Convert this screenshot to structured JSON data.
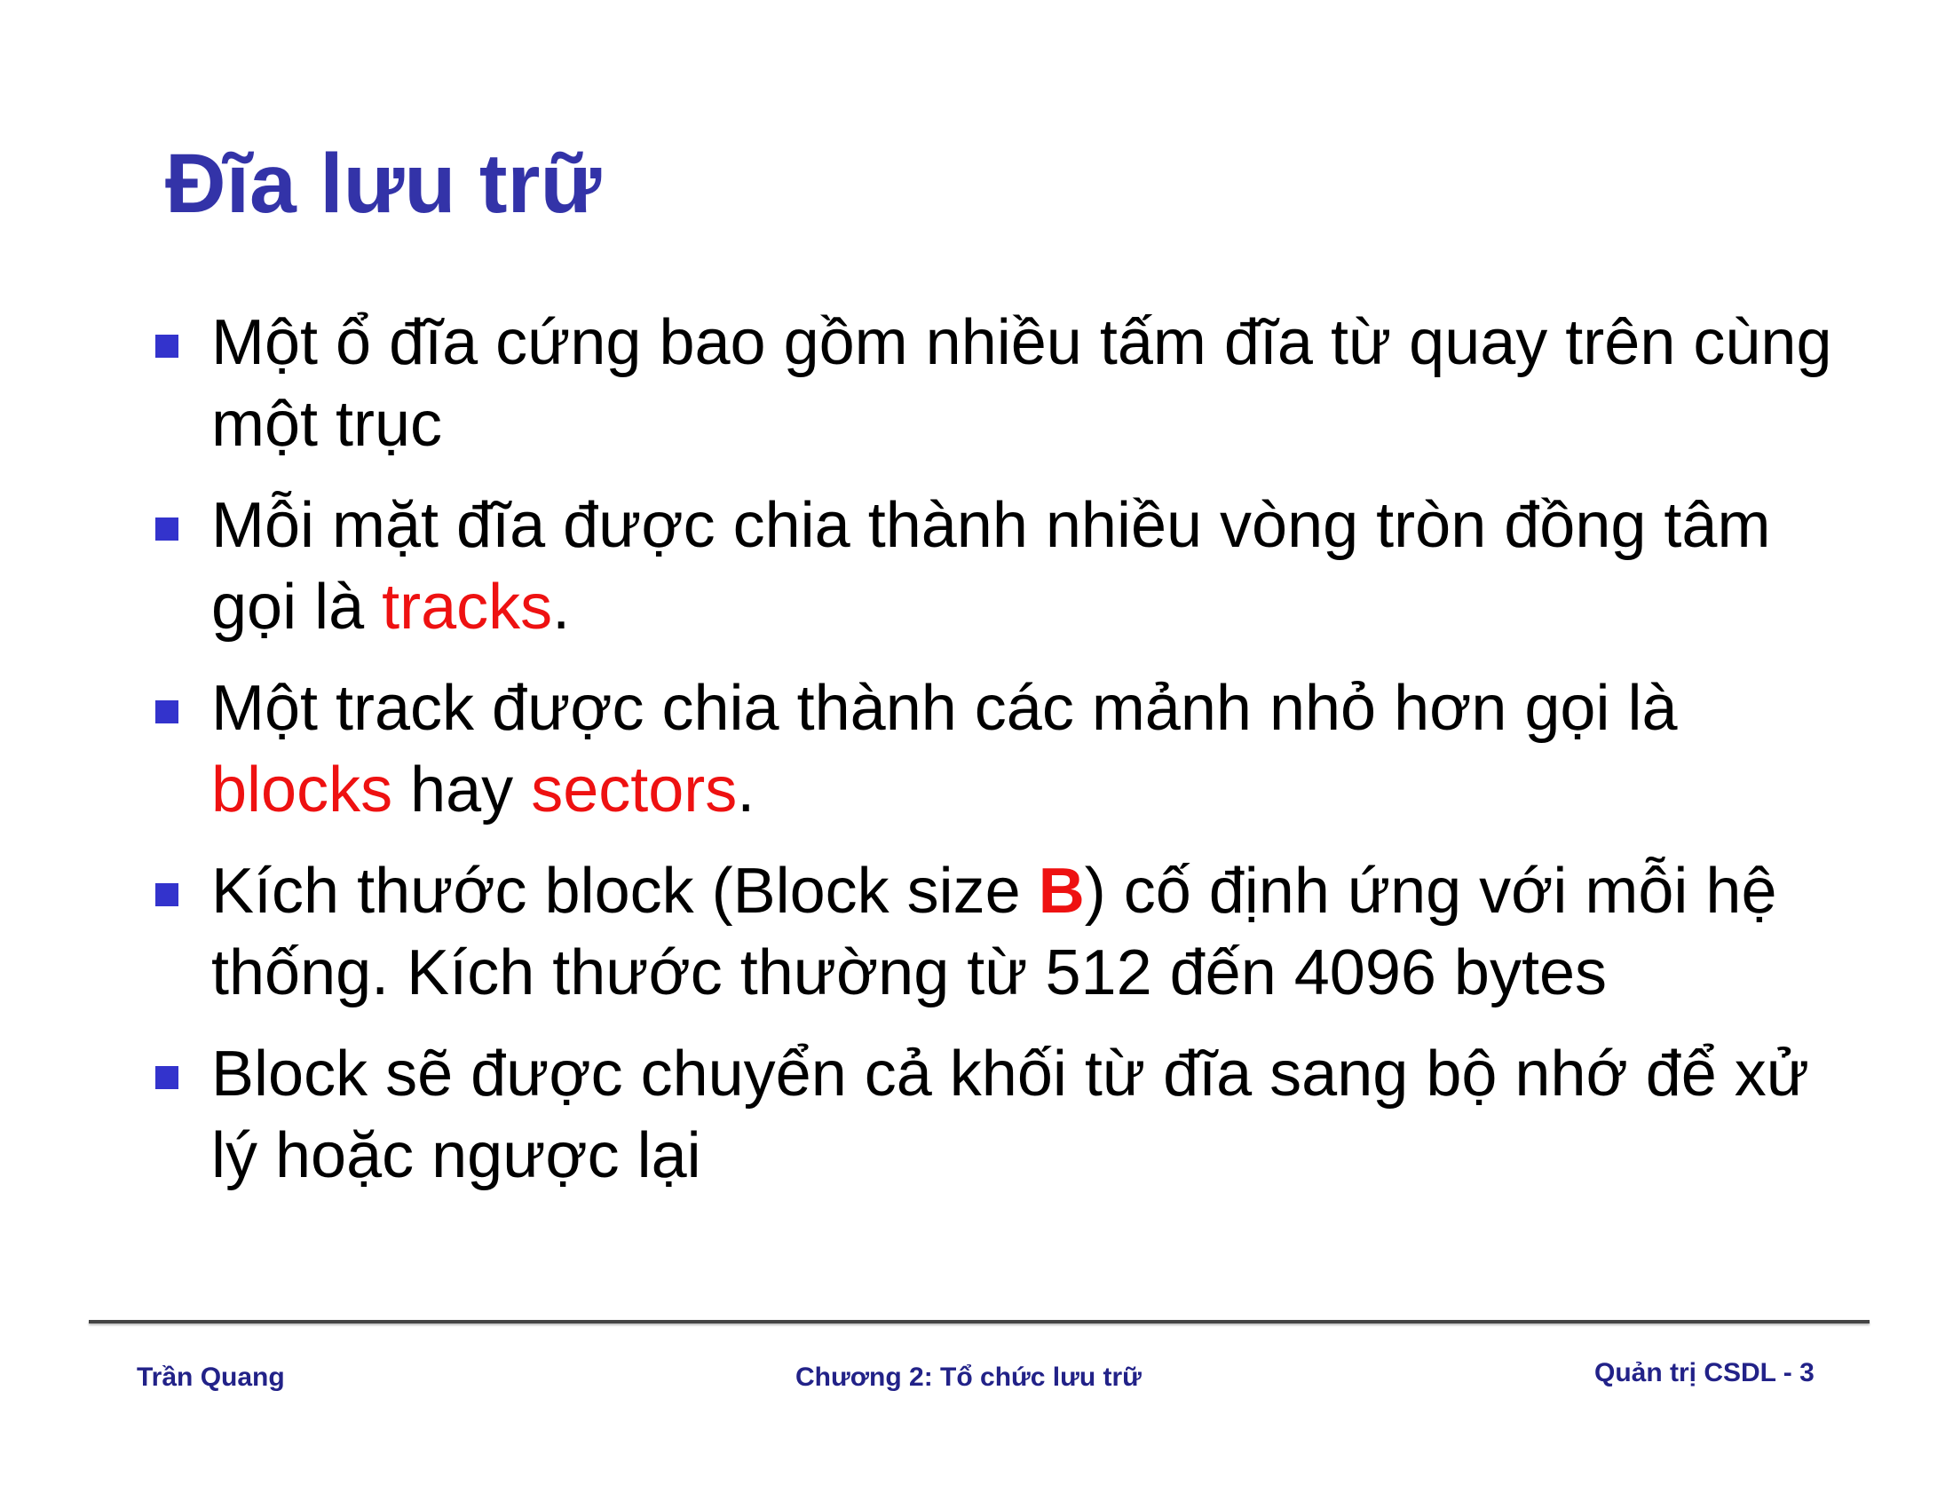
{
  "title": "Đĩa lưu trữ",
  "bullets": [
    {
      "text": "Một ổ đĩa cứng bao gồm nhiều tấm đĩa từ quay trên cùng một trục"
    },
    {
      "text_before": "Mỗi mặt đĩa được chia thành nhiều vòng tròn đồng tâm gọi là ",
      "highlight": "tracks",
      "text_after": "."
    },
    {
      "text_before": "Một track được chia thành các mảnh nhỏ hơn gọi là ",
      "highlight_1": "blocks",
      "text_middle": " hay ",
      "highlight_2": "sectors",
      "text_after": "."
    },
    {
      "text_before": "Kích thước block (Block size ",
      "highlight": "B",
      "text_after": ") cố định ứng với mỗi hệ thống. Kích thước thường từ 512 đến 4096 bytes"
    },
    {
      "text": "Block sẽ được chuyển cả khối từ đĩa sang bộ nhớ để xử lý hoặc ngược lại"
    }
  ],
  "footer": {
    "author": "Trần Quang",
    "chapter": "Chương 2: Tổ chức lưu trữ",
    "page": "Quản trị CSDL - 3"
  },
  "colors": {
    "title": "#3333a8",
    "bullet_marker": "#3333cc",
    "highlight": "#ee1111",
    "footer": "#222288"
  }
}
